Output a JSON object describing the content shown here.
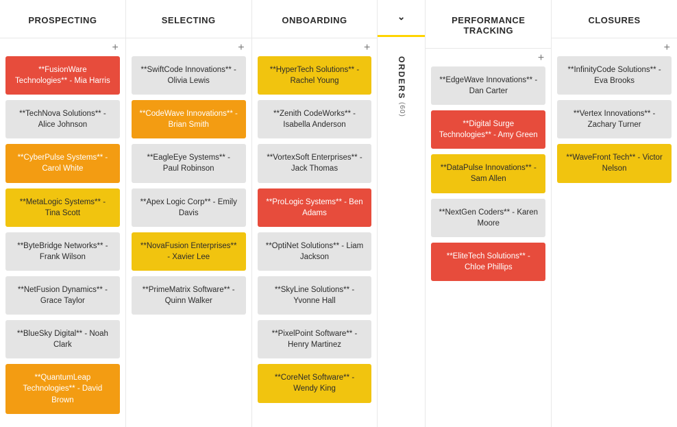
{
  "columns": [
    {
      "id": "prospecting",
      "title": "PROSPECTING",
      "collapsed": false,
      "add_label": "+",
      "cards": [
        {
          "label": "**FusionWare Technologies** - Mia Harris",
          "color": "red"
        },
        {
          "label": "**TechNova Solutions** - Alice Johnson",
          "color": "gray"
        },
        {
          "label": "**CyberPulse Systems** - Carol White",
          "color": "orange"
        },
        {
          "label": "**MetaLogic Systems** - Tina Scott",
          "color": "yellow"
        },
        {
          "label": "**ByteBridge Networks** - Frank Wilson",
          "color": "gray"
        },
        {
          "label": "**NetFusion Dynamics** - Grace Taylor",
          "color": "gray"
        },
        {
          "label": "**BlueSky Digital** - Noah Clark",
          "color": "gray"
        },
        {
          "label": "**QuantumLeap Technologies** - David Brown",
          "color": "orange"
        }
      ]
    },
    {
      "id": "selecting",
      "title": "SELECTING",
      "collapsed": false,
      "add_label": "+",
      "cards": [
        {
          "label": "**SwiftCode Innovations** - Olivia Lewis",
          "color": "gray"
        },
        {
          "label": "**CodeWave Innovations** - Brian Smith",
          "color": "orange"
        },
        {
          "label": "**EagleEye Systems** - Paul Robinson",
          "color": "gray"
        },
        {
          "label": "**Apex Logic Corp** - Emily Davis",
          "color": "gray"
        },
        {
          "label": "**NovaFusion Enterprises** - Xavier Lee",
          "color": "yellow"
        },
        {
          "label": "**PrimeMatrix Software** - Quinn Walker",
          "color": "gray"
        }
      ]
    },
    {
      "id": "onboarding",
      "title": "ONBOARDING",
      "collapsed": false,
      "add_label": "+",
      "cards": [
        {
          "label": "**HyperTech Solutions** - Rachel Young",
          "color": "yellow"
        },
        {
          "label": "**Zenith CodeWorks** - Isabella Anderson",
          "color": "gray"
        },
        {
          "label": "**VortexSoft Enterprises** - Jack Thomas",
          "color": "gray"
        },
        {
          "label": "**ProLogic Systems** - Ben Adams",
          "color": "red"
        },
        {
          "label": "**OptiNet Solutions** - Liam Jackson",
          "color": "gray"
        },
        {
          "label": "**SkyLine Solutions** - Yvonne Hall",
          "color": "gray"
        },
        {
          "label": "**PixelPoint Software** - Henry Martinez",
          "color": "gray"
        },
        {
          "label": "**CoreNet Software** - Wendy King",
          "color": "yellow"
        }
      ]
    },
    {
      "id": "orders",
      "title": "",
      "collapsed": true,
      "chevron": "⌄",
      "collapsed_label": "ORDERS",
      "collapsed_count": "(60)"
    },
    {
      "id": "performance-tracking",
      "title": "PERFORMANCE TRACKING",
      "collapsed": false,
      "add_label": "+",
      "cards": [
        {
          "label": "**EdgeWave Innovations** - Dan Carter",
          "color": "gray"
        },
        {
          "label": "**Digital Surge Technologies** - Amy Green",
          "color": "red"
        },
        {
          "label": "**DataPulse Innovations** - Sam Allen",
          "color": "yellow"
        },
        {
          "label": "**NextGen Coders** - Karen Moore",
          "color": "gray"
        },
        {
          "label": "**EliteTech Solutions** - Chloe Phillips",
          "color": "red"
        }
      ]
    },
    {
      "id": "closures",
      "title": "CLOSURES",
      "collapsed": false,
      "add_label": "+",
      "cards": [
        {
          "label": "**InfinityCode Solutions** - Eva Brooks",
          "color": "gray"
        },
        {
          "label": "**Vertex Innovations** - Zachary Turner",
          "color": "gray"
        },
        {
          "label": "**WaveFront Tech** - Victor Nelson",
          "color": "yellow"
        }
      ]
    }
  ]
}
